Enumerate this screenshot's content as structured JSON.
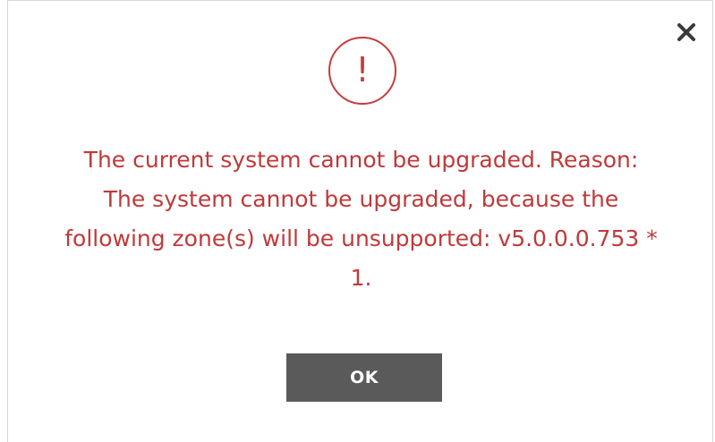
{
  "dialog": {
    "icon": "alert-circle-icon",
    "alert_glyph": "!",
    "close_icon": "close-icon",
    "message_lines": [
      "The current system cannot be upgraded. Reason:",
      "The system cannot be upgraded, because the",
      "following zone(s) will be unsupported: v5.0.0.0.753 *",
      "1."
    ],
    "ok_label": "OK",
    "colors": {
      "message": "#c0393a",
      "button_bg": "#5a5a5a",
      "button_text": "#ffffff",
      "close_icon": "#3a3a3a"
    }
  }
}
